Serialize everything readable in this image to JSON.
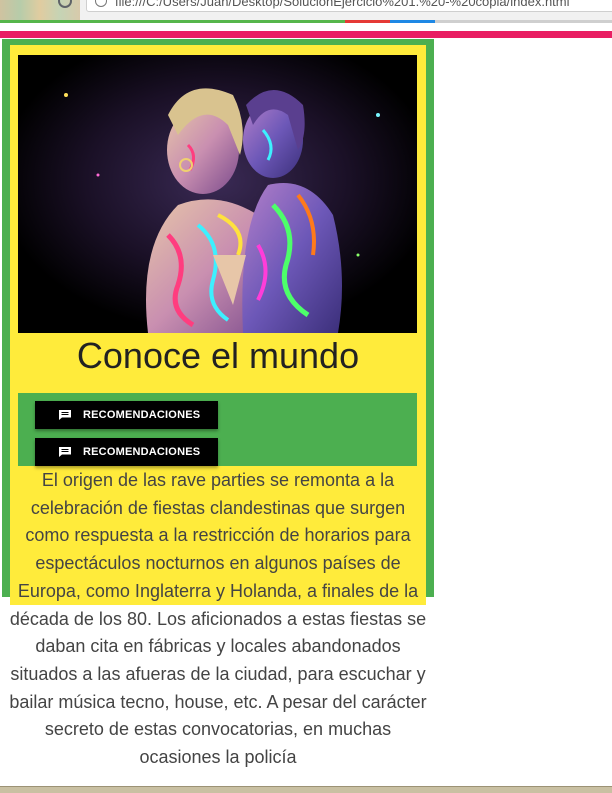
{
  "browser": {
    "url_fragment": "file:///C:/Users/Juan/Desktop/SolucionEjercicio%201.%20-%20copia/index.html"
  },
  "hero_image": {
    "alt": "two women with neon body paint embracing"
  },
  "card": {
    "title": "Conoce el mundo",
    "buttons": [
      {
        "label": "RECOMENDACIONES",
        "icon": "chat-bubble-icon"
      },
      {
        "label": "RECOMENDACIONES",
        "icon": "chat-bubble-icon"
      }
    ],
    "paragraph": "El origen de las rave parties se remonta a la celebración de fiestas clandestinas que surgen como respuesta a la restricción de horarios para espectáculos nocturnos en algunos países de Europa, como Inglaterra y Holanda, a finales de la década de los 80. Los aficionados a estas fiestas se daban cita en fábricas y locales abandonados situados a las afueras de la ciudad, para escuchar y bailar música tecno, house, etc. A pesar del carácter secreto de estas convocatorias, en muchas ocasiones la policía"
  },
  "colors": {
    "green": "#4caf50",
    "yellow": "#ffeb3b",
    "pink": "#e91e63",
    "button_bg": "#000000"
  }
}
